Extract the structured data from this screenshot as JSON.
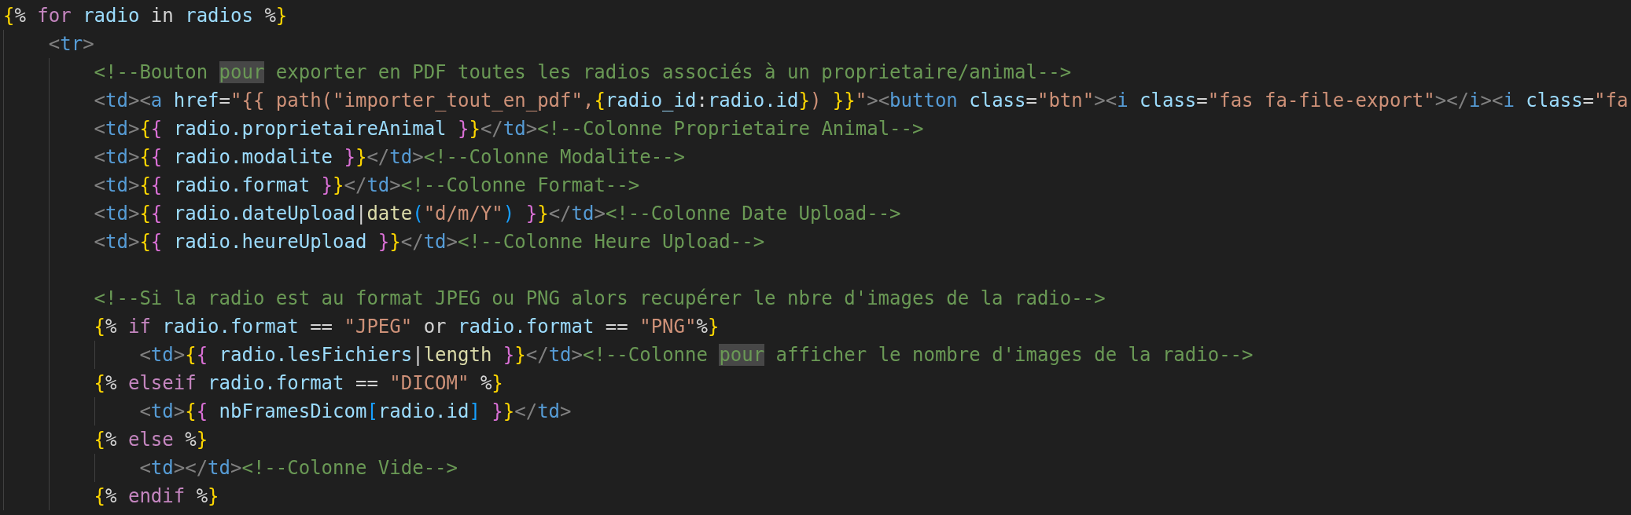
{
  "editor": {
    "lines": [
      {
        "kind": "code",
        "tokens": [
          {
            "text": "{",
            "kind": "y"
          },
          {
            "text": "% ",
            "kind": "tx"
          },
          {
            "text": "for ",
            "kind": "kw"
          },
          {
            "text": "radio ",
            "kind": "v"
          },
          {
            "text": "in ",
            "kind": "tx"
          },
          {
            "text": "radios ",
            "kind": "v"
          },
          {
            "text": "%",
            "kind": "tx"
          },
          {
            "text": "}",
            "kind": "y"
          }
        ],
        "children": [
          {
            "kind": "code",
            "tokens": [
              {
                "text": "<",
                "kind": "p"
              },
              {
                "text": "tr",
                "kind": "tag"
              },
              {
                "text": ">",
                "kind": "p"
              }
            ],
            "children": [
              {
                "kind": "code",
                "tokens": [
                  {
                    "text": "<!--Bouton ",
                    "kind": "cm"
                  },
                  {
                    "text": "pour",
                    "kind": "hl"
                  },
                  {
                    "text": " exporter en PDF toutes les radios associés à un proprietaire/animal-->",
                    "kind": "cm"
                  }
                ]
              },
              {
                "kind": "code",
                "tokens": [
                  {
                    "text": "<",
                    "kind": "p"
                  },
                  {
                    "text": "td",
                    "kind": "tag"
                  },
                  {
                    "text": "><",
                    "kind": "p"
                  },
                  {
                    "text": "a ",
                    "kind": "tag"
                  },
                  {
                    "text": "href",
                    "kind": "attr"
                  },
                  {
                    "text": "=",
                    "kind": "tx"
                  },
                  {
                    "text": "\"{{ path(\"importer_tout_en_pdf\",",
                    "kind": "str"
                  },
                  {
                    "text": "{",
                    "kind": "y"
                  },
                  {
                    "text": "radio_id",
                    "kind": "v"
                  },
                  {
                    "text": ":",
                    "kind": "tx"
                  },
                  {
                    "text": "radio.id",
                    "kind": "v"
                  },
                  {
                    "text": "}",
                    "kind": "y"
                  },
                  {
                    "text": ") ",
                    "kind": "str"
                  },
                  {
                    "text": "}}",
                    "kind": "y"
                  },
                  {
                    "text": "\"",
                    "kind": "str"
                  },
                  {
                    "text": "><",
                    "kind": "p"
                  },
                  {
                    "text": "button ",
                    "kind": "tag"
                  },
                  {
                    "text": "class",
                    "kind": "attr"
                  },
                  {
                    "text": "=",
                    "kind": "tx"
                  },
                  {
                    "text": "\"btn\"",
                    "kind": "str"
                  },
                  {
                    "text": "><",
                    "kind": "p"
                  },
                  {
                    "text": "i ",
                    "kind": "tag"
                  },
                  {
                    "text": "class",
                    "kind": "attr"
                  },
                  {
                    "text": "=",
                    "kind": "tx"
                  },
                  {
                    "text": "\"fas fa-file-export\"",
                    "kind": "str"
                  },
                  {
                    "text": "></",
                    "kind": "p"
                  },
                  {
                    "text": "i",
                    "kind": "tag"
                  },
                  {
                    "text": "><",
                    "kind": "p"
                  },
                  {
                    "text": "i ",
                    "kind": "tag"
                  },
                  {
                    "text": "class",
                    "kind": "attr"
                  },
                  {
                    "text": "=",
                    "kind": "tx"
                  },
                  {
                    "text": "\"fa",
                    "kind": "str"
                  }
                ]
              },
              {
                "kind": "code",
                "tokens": [
                  {
                    "text": "<",
                    "kind": "p"
                  },
                  {
                    "text": "td",
                    "kind": "tag"
                  },
                  {
                    "text": ">",
                    "kind": "p"
                  },
                  {
                    "text": "{",
                    "kind": "y"
                  },
                  {
                    "text": "{ ",
                    "kind": "m"
                  },
                  {
                    "text": "radio.proprietaireAnimal ",
                    "kind": "v"
                  },
                  {
                    "text": "}",
                    "kind": "m"
                  },
                  {
                    "text": "}",
                    "kind": "y"
                  },
                  {
                    "text": "</",
                    "kind": "p"
                  },
                  {
                    "text": "td",
                    "kind": "tag"
                  },
                  {
                    "text": ">",
                    "kind": "p"
                  },
                  {
                    "text": "<!--Colonne Proprietaire Animal-->",
                    "kind": "cm"
                  }
                ]
              },
              {
                "kind": "code",
                "tokens": [
                  {
                    "text": "<",
                    "kind": "p"
                  },
                  {
                    "text": "td",
                    "kind": "tag"
                  },
                  {
                    "text": ">",
                    "kind": "p"
                  },
                  {
                    "text": "{",
                    "kind": "y"
                  },
                  {
                    "text": "{ ",
                    "kind": "m"
                  },
                  {
                    "text": "radio.modalite ",
                    "kind": "v"
                  },
                  {
                    "text": "}",
                    "kind": "m"
                  },
                  {
                    "text": "}",
                    "kind": "y"
                  },
                  {
                    "text": "</",
                    "kind": "p"
                  },
                  {
                    "text": "td",
                    "kind": "tag"
                  },
                  {
                    "text": ">",
                    "kind": "p"
                  },
                  {
                    "text": "<!--Colonne Modalite-->",
                    "kind": "cm"
                  }
                ]
              },
              {
                "kind": "code",
                "tokens": [
                  {
                    "text": "<",
                    "kind": "p"
                  },
                  {
                    "text": "td",
                    "kind": "tag"
                  },
                  {
                    "text": ">",
                    "kind": "p"
                  },
                  {
                    "text": "{",
                    "kind": "y"
                  },
                  {
                    "text": "{ ",
                    "kind": "m"
                  },
                  {
                    "text": "radio.format ",
                    "kind": "v"
                  },
                  {
                    "text": "}",
                    "kind": "m"
                  },
                  {
                    "text": "}",
                    "kind": "y"
                  },
                  {
                    "text": "</",
                    "kind": "p"
                  },
                  {
                    "text": "td",
                    "kind": "tag"
                  },
                  {
                    "text": ">",
                    "kind": "p"
                  },
                  {
                    "text": "<!--Colonne Format-->",
                    "kind": "cm"
                  }
                ]
              },
              {
                "kind": "code",
                "tokens": [
                  {
                    "text": "<",
                    "kind": "p"
                  },
                  {
                    "text": "td",
                    "kind": "tag"
                  },
                  {
                    "text": ">",
                    "kind": "p"
                  },
                  {
                    "text": "{",
                    "kind": "y"
                  },
                  {
                    "text": "{ ",
                    "kind": "m"
                  },
                  {
                    "text": "radio.dateUpload",
                    "kind": "v"
                  },
                  {
                    "text": "|",
                    "kind": "tx"
                  },
                  {
                    "text": "date",
                    "kind": "fn"
                  },
                  {
                    "text": "(",
                    "kind": "b"
                  },
                  {
                    "text": "\"d/m/Y\"",
                    "kind": "str"
                  },
                  {
                    "text": ") ",
                    "kind": "b"
                  },
                  {
                    "text": "}",
                    "kind": "m"
                  },
                  {
                    "text": "}",
                    "kind": "y"
                  },
                  {
                    "text": "</",
                    "kind": "p"
                  },
                  {
                    "text": "td",
                    "kind": "tag"
                  },
                  {
                    "text": ">",
                    "kind": "p"
                  },
                  {
                    "text": "<!--Colonne Date Upload-->",
                    "kind": "cm"
                  }
                ]
              },
              {
                "kind": "code",
                "tokens": [
                  {
                    "text": "<",
                    "kind": "p"
                  },
                  {
                    "text": "td",
                    "kind": "tag"
                  },
                  {
                    "text": ">",
                    "kind": "p"
                  },
                  {
                    "text": "{",
                    "kind": "y"
                  },
                  {
                    "text": "{ ",
                    "kind": "m"
                  },
                  {
                    "text": "radio.heureUpload ",
                    "kind": "v"
                  },
                  {
                    "text": "}",
                    "kind": "m"
                  },
                  {
                    "text": "}",
                    "kind": "y"
                  },
                  {
                    "text": "</",
                    "kind": "p"
                  },
                  {
                    "text": "td",
                    "kind": "tag"
                  },
                  {
                    "text": ">",
                    "kind": "p"
                  },
                  {
                    "text": "<!--Colonne Heure Upload-->",
                    "kind": "cm"
                  }
                ]
              },
              {
                "kind": "blank"
              },
              {
                "kind": "code",
                "tokens": [
                  {
                    "text": "<!--Si la radio est au format JPEG ou PNG alors recupérer le nbre d'images de la radio-->",
                    "kind": "cm"
                  }
                ]
              },
              {
                "kind": "code",
                "tokens": [
                  {
                    "text": "{",
                    "kind": "y"
                  },
                  {
                    "text": "% ",
                    "kind": "tx"
                  },
                  {
                    "text": "if ",
                    "kind": "kw"
                  },
                  {
                    "text": "radio.format ",
                    "kind": "v"
                  },
                  {
                    "text": "== ",
                    "kind": "tx"
                  },
                  {
                    "text": "\"JPEG\"",
                    "kind": "str"
                  },
                  {
                    "text": " or ",
                    "kind": "tx"
                  },
                  {
                    "text": "radio.format ",
                    "kind": "v"
                  },
                  {
                    "text": "== ",
                    "kind": "tx"
                  },
                  {
                    "text": "\"PNG\"",
                    "kind": "str"
                  },
                  {
                    "text": "%",
                    "kind": "tx"
                  },
                  {
                    "text": "}",
                    "kind": "y"
                  }
                ],
                "children": [
                  {
                    "kind": "code",
                    "tokens": [
                      {
                        "text": "<",
                        "kind": "p"
                      },
                      {
                        "text": "td",
                        "kind": "tag"
                      },
                      {
                        "text": ">",
                        "kind": "p"
                      },
                      {
                        "text": "{",
                        "kind": "y"
                      },
                      {
                        "text": "{ ",
                        "kind": "m"
                      },
                      {
                        "text": "radio.lesFichiers",
                        "kind": "v"
                      },
                      {
                        "text": "|",
                        "kind": "tx"
                      },
                      {
                        "text": "length ",
                        "kind": "fn"
                      },
                      {
                        "text": "}",
                        "kind": "m"
                      },
                      {
                        "text": "}",
                        "kind": "y"
                      },
                      {
                        "text": "</",
                        "kind": "p"
                      },
                      {
                        "text": "td",
                        "kind": "tag"
                      },
                      {
                        "text": ">",
                        "kind": "p"
                      },
                      {
                        "text": "<!--Colonne ",
                        "kind": "cm"
                      },
                      {
                        "text": "pour",
                        "kind": "hl"
                      },
                      {
                        "text": " afficher le nombre d'images de la radio-->",
                        "kind": "cm"
                      }
                    ]
                  }
                ]
              },
              {
                "kind": "code",
                "tokens": [
                  {
                    "text": "{",
                    "kind": "y"
                  },
                  {
                    "text": "% ",
                    "kind": "tx"
                  },
                  {
                    "text": "elseif ",
                    "kind": "kw"
                  },
                  {
                    "text": "radio.format ",
                    "kind": "v"
                  },
                  {
                    "text": "== ",
                    "kind": "tx"
                  },
                  {
                    "text": "\"DICOM\" ",
                    "kind": "str"
                  },
                  {
                    "text": "%",
                    "kind": "tx"
                  },
                  {
                    "text": "}",
                    "kind": "y"
                  }
                ],
                "children": [
                  {
                    "kind": "code",
                    "tokens": [
                      {
                        "text": "<",
                        "kind": "p"
                      },
                      {
                        "text": "td",
                        "kind": "tag"
                      },
                      {
                        "text": ">",
                        "kind": "p"
                      },
                      {
                        "text": "{",
                        "kind": "y"
                      },
                      {
                        "text": "{ ",
                        "kind": "m"
                      },
                      {
                        "text": "nbFramesDicom",
                        "kind": "v"
                      },
                      {
                        "text": "[",
                        "kind": "b"
                      },
                      {
                        "text": "radio.id",
                        "kind": "v"
                      },
                      {
                        "text": "] ",
                        "kind": "b"
                      },
                      {
                        "text": "}",
                        "kind": "m"
                      },
                      {
                        "text": "}",
                        "kind": "y"
                      },
                      {
                        "text": "</",
                        "kind": "p"
                      },
                      {
                        "text": "td",
                        "kind": "tag"
                      },
                      {
                        "text": ">",
                        "kind": "p"
                      }
                    ]
                  }
                ]
              },
              {
                "kind": "code",
                "tokens": [
                  {
                    "text": "{",
                    "kind": "y"
                  },
                  {
                    "text": "% ",
                    "kind": "tx"
                  },
                  {
                    "text": "else ",
                    "kind": "kw"
                  },
                  {
                    "text": "%",
                    "kind": "tx"
                  },
                  {
                    "text": "}",
                    "kind": "y"
                  }
                ],
                "children": [
                  {
                    "kind": "code",
                    "tokens": [
                      {
                        "text": "<",
                        "kind": "p"
                      },
                      {
                        "text": "td",
                        "kind": "tag"
                      },
                      {
                        "text": "></",
                        "kind": "p"
                      },
                      {
                        "text": "td",
                        "kind": "tag"
                      },
                      {
                        "text": ">",
                        "kind": "p"
                      },
                      {
                        "text": "<!--Colonne Vide-->",
                        "kind": "cm"
                      }
                    ]
                  }
                ]
              },
              {
                "kind": "code",
                "tokens": [
                  {
                    "text": "{",
                    "kind": "y"
                  },
                  {
                    "text": "% ",
                    "kind": "tx"
                  },
                  {
                    "text": "endif ",
                    "kind": "kw"
                  },
                  {
                    "text": "%",
                    "kind": "tx"
                  },
                  {
                    "text": "}",
                    "kind": "y"
                  }
                ]
              }
            ]
          }
        ]
      }
    ]
  }
}
